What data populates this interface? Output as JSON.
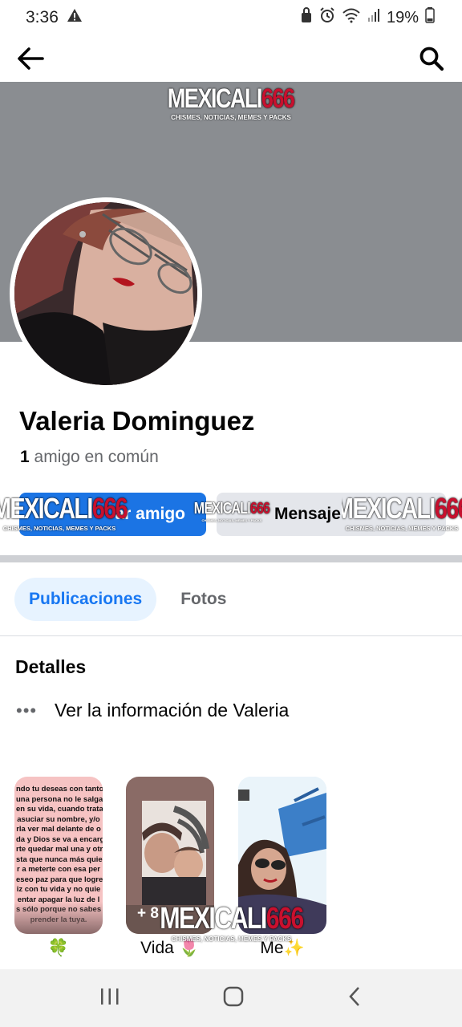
{
  "status_bar": {
    "time": "3:36",
    "battery": "19%"
  },
  "nav": {
    "back_icon": "arrow-left-icon",
    "search_icon": "search-icon"
  },
  "watermark": {
    "main": "MEXICALI",
    "number": "666",
    "sub": "CHISMES, NOTICIAS, MEMES Y PACKS"
  },
  "profile": {
    "name": "Valeria Dominguez",
    "mutual_count": "1",
    "mutual_text": "amigo en común"
  },
  "actions": {
    "add_friend": "ar amigo",
    "message": "Mensaje"
  },
  "tabs": [
    {
      "label": "Publicaciones",
      "active": true
    },
    {
      "label": "Fotos",
      "active": false
    }
  ],
  "details": {
    "title": "Detalles",
    "info": "Ver la información de Valeria"
  },
  "highlights": [
    {
      "label": "🍀",
      "text_lines": [
        "ndo tu deseas con tanto",
        "una persona no le salga",
        "en su vida, cuando trata",
        "asuciar su nombre, y/o",
        "rla ver mal delante de o",
        "da y Dios se va a encarg",
        "rte quedar mal una y otr",
        "sta que nunca más quie",
        "r a meterte con esa per",
        "eseo paz para que logre",
        "iz con tu vida y no quie",
        "entar apagar la luz de l",
        "s sólo porque no sabes",
        "prender la tuya."
      ]
    },
    {
      "label": "Vida 🌷",
      "badge": "+ 8"
    },
    {
      "label": "Me✨"
    }
  ],
  "colors": {
    "accent": "#1b74e4",
    "cover": "#8a8d91",
    "tab_active_bg": "#e7f3ff"
  }
}
